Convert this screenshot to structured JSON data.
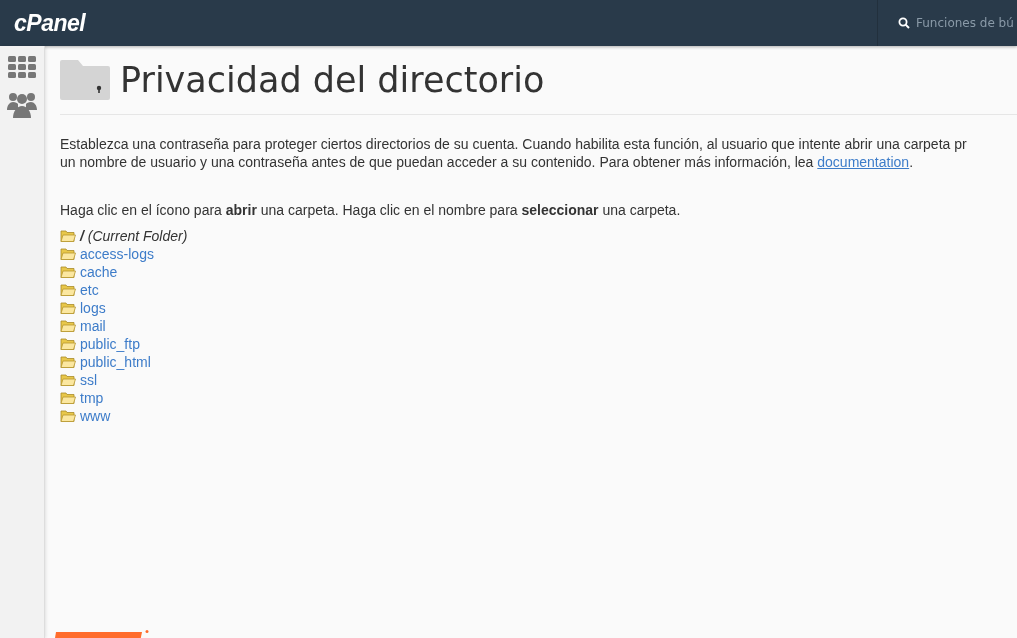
{
  "header": {
    "logo": "cPanel",
    "search": {
      "placeholder": "Funciones de bú"
    }
  },
  "page": {
    "title": "Privacidad del directorio",
    "intro_lines": [
      "Establezca una contraseña para proteger ciertos directorios de su cuenta. Cuando habilita esta función, al usuario que intente abrir una carpeta pr",
      "un nombre de usuario y una contraseña antes de que puedan acceder a su contenido. Para obtener más información, lea "
    ],
    "intro_link": "documentation",
    "intro_suffix": ".",
    "instruction": "Haga clic en el ícono para **abrir** una carpeta. Haga clic en el nombre para **seleccionar** una carpeta.",
    "folders": [
      {
        "kind": "current",
        "slash": "/",
        "label": "(Current Folder)"
      },
      {
        "kind": "folder",
        "label": "access-logs"
      },
      {
        "kind": "folder",
        "label": "cache"
      },
      {
        "kind": "folder",
        "label": "etc"
      },
      {
        "kind": "folder",
        "label": "logs"
      },
      {
        "kind": "folder",
        "label": "mail"
      },
      {
        "kind": "folder",
        "label": "public_ftp"
      },
      {
        "kind": "folder",
        "label": "public_html"
      },
      {
        "kind": "folder",
        "label": "ssl"
      },
      {
        "kind": "folder",
        "label": "tmp"
      },
      {
        "kind": "folder",
        "label": "www"
      }
    ]
  }
}
